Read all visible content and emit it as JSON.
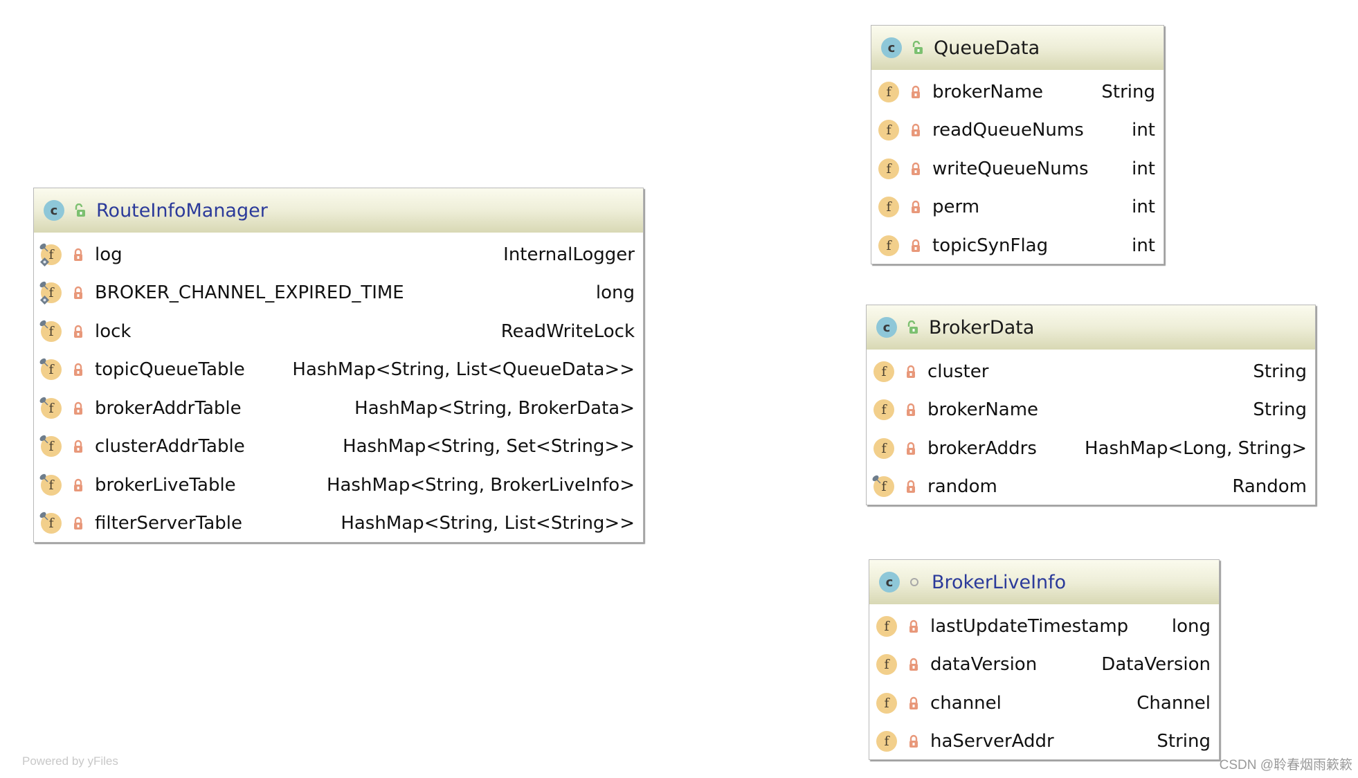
{
  "diagram": {
    "classes": [
      {
        "id": "route-info-manager",
        "name": "RouteInfoManager",
        "kind_icon": "class-icon",
        "kind_letter": "c",
        "visibility_icon": "public-icon",
        "title_style": "blue",
        "fields": [
          {
            "name": "log",
            "type": "InternalLogger",
            "modifiers": [
              "static",
              "final"
            ],
            "visibility": "private"
          },
          {
            "name": "BROKER_CHANNEL_EXPIRED_TIME",
            "type": "long",
            "modifiers": [
              "static",
              "final"
            ],
            "visibility": "private"
          },
          {
            "name": "lock",
            "type": "ReadWriteLock",
            "modifiers": [
              "final"
            ],
            "visibility": "private"
          },
          {
            "name": "topicQueueTable",
            "type": "HashMap<String, List<QueueData>>",
            "modifiers": [
              "final"
            ],
            "visibility": "private"
          },
          {
            "name": "brokerAddrTable",
            "type": "HashMap<String, BrokerData>",
            "modifiers": [
              "final"
            ],
            "visibility": "private"
          },
          {
            "name": "clusterAddrTable",
            "type": "HashMap<String, Set<String>>",
            "modifiers": [
              "final"
            ],
            "visibility": "private"
          },
          {
            "name": "brokerLiveTable",
            "type": "HashMap<String, BrokerLiveInfo>",
            "modifiers": [
              "final"
            ],
            "visibility": "private"
          },
          {
            "name": "filterServerTable",
            "type": "HashMap<String, List<String>>",
            "modifiers": [
              "final"
            ],
            "visibility": "private"
          }
        ]
      },
      {
        "id": "queue-data",
        "name": "QueueData",
        "kind_icon": "class-icon",
        "kind_letter": "c",
        "visibility_icon": "public-icon",
        "title_style": "dark",
        "fields": [
          {
            "name": "brokerName",
            "type": "String",
            "modifiers": [],
            "visibility": "private"
          },
          {
            "name": "readQueueNums",
            "type": "int",
            "modifiers": [],
            "visibility": "private"
          },
          {
            "name": "writeQueueNums",
            "type": "int",
            "modifiers": [],
            "visibility": "private"
          },
          {
            "name": "perm",
            "type": "int",
            "modifiers": [],
            "visibility": "private"
          },
          {
            "name": "topicSynFlag",
            "type": "int",
            "modifiers": [],
            "visibility": "private"
          }
        ]
      },
      {
        "id": "broker-data",
        "name": "BrokerData",
        "kind_icon": "class-icon",
        "kind_letter": "c",
        "visibility_icon": "public-icon",
        "title_style": "dark",
        "fields": [
          {
            "name": "cluster",
            "type": "String",
            "modifiers": [],
            "visibility": "private"
          },
          {
            "name": "brokerName",
            "type": "String",
            "modifiers": [],
            "visibility": "private"
          },
          {
            "name": "brokerAddrs",
            "type": "HashMap<Long, String>",
            "modifiers": [],
            "visibility": "private"
          },
          {
            "name": "random",
            "type": "Random",
            "modifiers": [
              "final"
            ],
            "visibility": "private"
          }
        ]
      },
      {
        "id": "broker-live-info",
        "name": "BrokerLiveInfo",
        "kind_icon": "class-icon",
        "kind_letter": "c",
        "visibility_icon": "package-private-icon",
        "title_style": "blue",
        "fields": [
          {
            "name": "lastUpdateTimestamp",
            "type": "long",
            "modifiers": [],
            "visibility": "private"
          },
          {
            "name": "dataVersion",
            "type": "DataVersion",
            "modifiers": [],
            "visibility": "private"
          },
          {
            "name": "channel",
            "type": "Channel",
            "modifiers": [],
            "visibility": "private"
          },
          {
            "name": "haServerAddr",
            "type": "String",
            "modifiers": [],
            "visibility": "private"
          }
        ]
      }
    ],
    "field_icon_letter": "f"
  },
  "footer": {
    "powered_by": "Powered by yFiles",
    "watermark": "CSDN @聆春烟雨簌簌"
  },
  "colors": {
    "class_icon": "#8ec7d8",
    "field_icon": "#f2cf8b",
    "private_lock": "#e8987a",
    "public_lock": "#7cc070",
    "title_blue": "#2b3a9a"
  }
}
